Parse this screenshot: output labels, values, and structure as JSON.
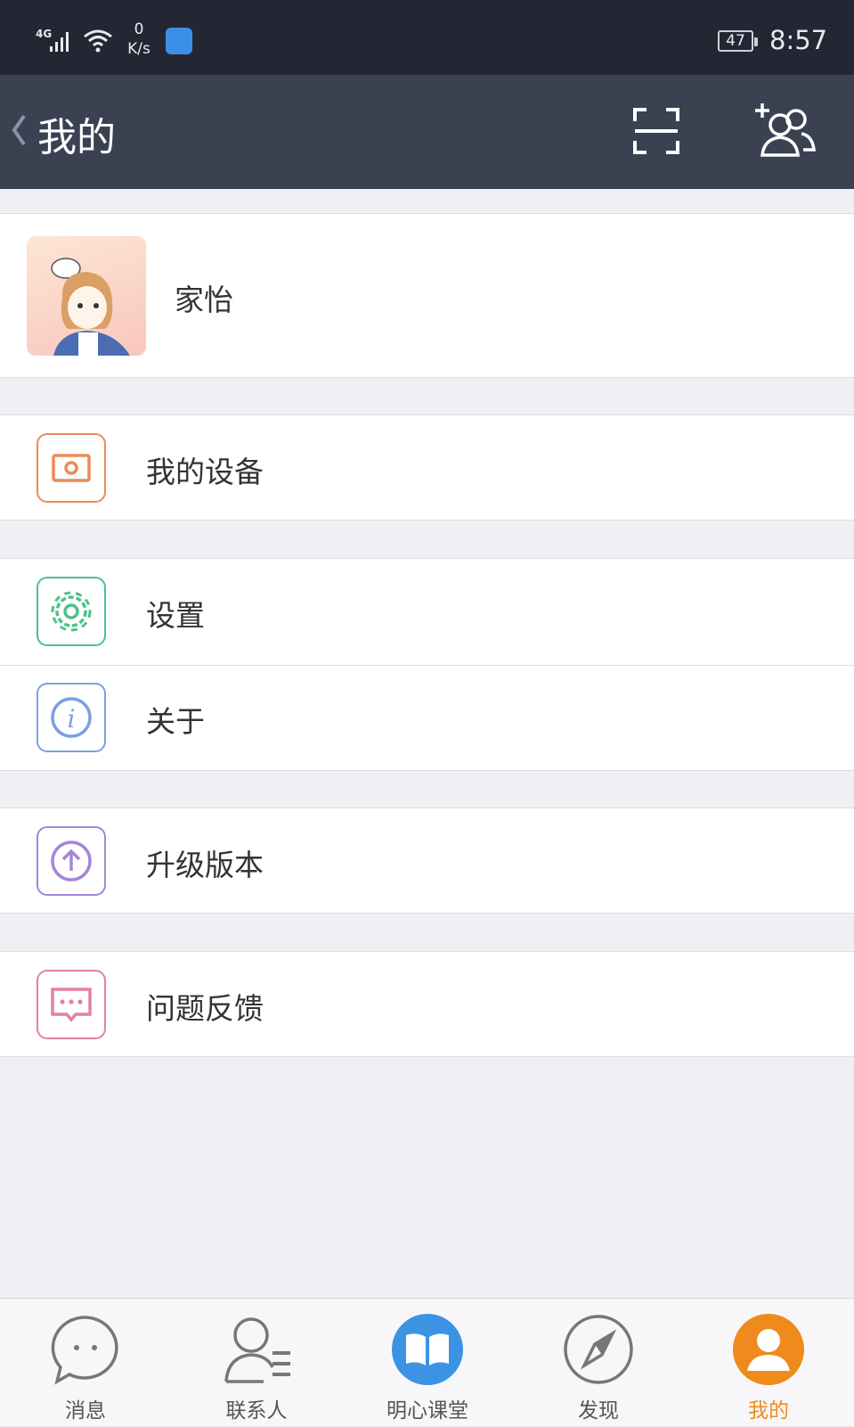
{
  "status_bar": {
    "network": "4G",
    "speed_value": "0",
    "speed_unit": "K/s",
    "battery": "47",
    "time": "8:57"
  },
  "header": {
    "title": "我的"
  },
  "profile": {
    "name": "家怡"
  },
  "menu": {
    "devices": "我的设备",
    "settings": "设置",
    "about": "关于",
    "upgrade": "升级版本",
    "feedback": "问题反馈"
  },
  "tabs": [
    {
      "label": "消息"
    },
    {
      "label": "联系人"
    },
    {
      "label": "明心课堂"
    },
    {
      "label": "发现"
    },
    {
      "label": "我的"
    }
  ],
  "colors": {
    "accent": "#f08a1c",
    "devices": "#e98d55",
    "settings": "#4cc28a",
    "about": "#7c9fe0",
    "upgrade": "#a486d8",
    "feedback": "#e4829a",
    "classroom": "#3c93e4"
  }
}
